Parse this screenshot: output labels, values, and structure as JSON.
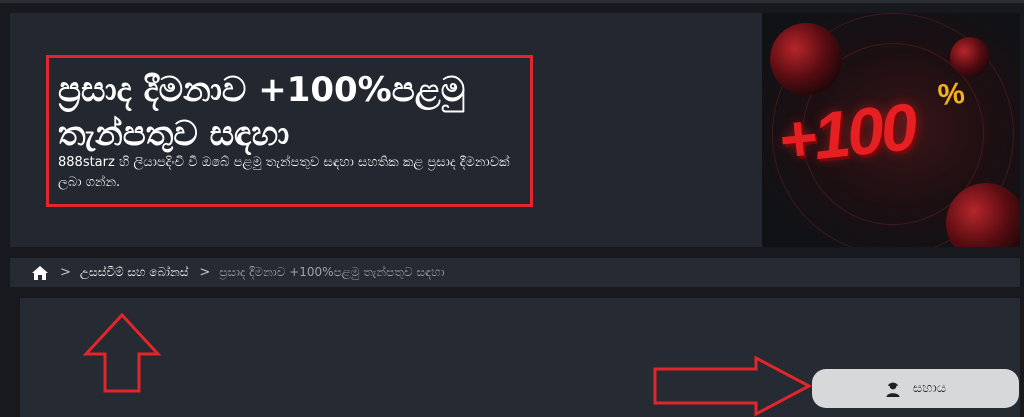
{
  "hero": {
    "title": "ප්‍රසාද දීමනාව +100%පළමු තැන්පතුව සඳහා",
    "subtitle": "888starz හි ලියාපදිංචි වී ඔබේ පළමු තැන්පතුව සඳහා සහතික කළ ප්‍රසාද දීමනාවක් ලබා ගන්න.",
    "promo": {
      "amount": "+100",
      "percent": "%"
    }
  },
  "breadcrumb": {
    "home_icon": "home-icon",
    "separator": ">",
    "items": [
      {
        "label": "උසස්වීම් සහ බෝනස්"
      },
      {
        "label": "ප්‍රසාද දීමනාව +100%පළමු තැන්පතුව සඳහා"
      }
    ]
  },
  "help_button": {
    "label": "සහාය",
    "icon": "support-agent-icon"
  },
  "colors": {
    "background": "#17191e",
    "panel": "#262a32",
    "hero": "#222730",
    "annotation_red": "#e2262b",
    "promo_red": "#e51f22",
    "promo_gold": "#f3b21b"
  }
}
